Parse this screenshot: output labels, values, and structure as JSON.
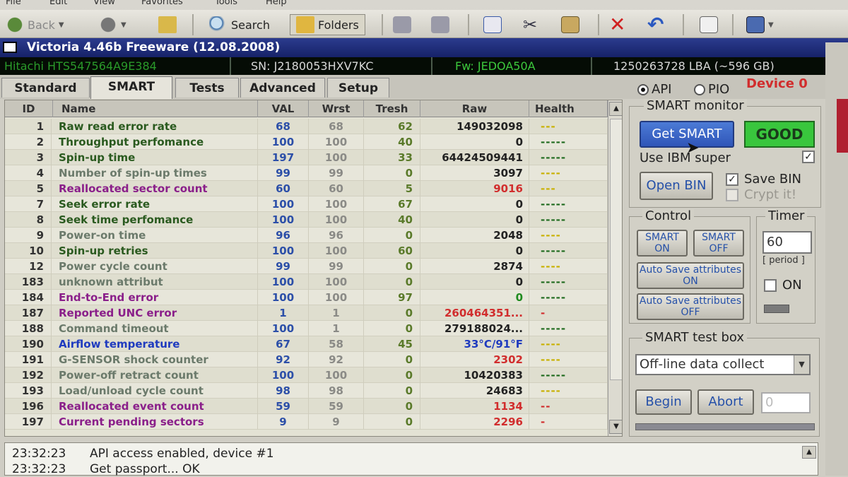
{
  "menu": [
    "File",
    "Edit",
    "View",
    "Favorites",
    "Tools",
    "Help"
  ],
  "toolbar": {
    "back": "Back",
    "search": "Search",
    "folders": "Folders"
  },
  "window": {
    "title": "Victoria 4.46b Freeware (12.08.2008)"
  },
  "drive_info": {
    "model": "Hitachi HTS547564A9E384",
    "serial": "SN: J2180053HXV7KC",
    "firmware": "Fw: JEDOA50A",
    "lba": "1250263728 LBA (~596 GB)"
  },
  "tabs": [
    "Standard",
    "SMART",
    "Tests",
    "Advanced",
    "Setup"
  ],
  "active_tab": "SMART",
  "mode": {
    "api": "API",
    "pio": "PIO",
    "selected": "API",
    "device": "Device 0"
  },
  "columns": [
    "ID",
    "Name",
    "VAL",
    "Wrst",
    "Tresh",
    "Raw",
    "Health"
  ],
  "rows": [
    {
      "id": "1",
      "name": "Raw read error rate",
      "val": "68",
      "wrst": "68",
      "tresh": "62",
      "raw": "149032098",
      "health": "---",
      "name_color": "#2a5a1f",
      "raw_color": "#222222",
      "health_color": "#c8b000"
    },
    {
      "id": "2",
      "name": "Throughput perfomance",
      "val": "100",
      "wrst": "100",
      "tresh": "40",
      "raw": "0",
      "health": "-----",
      "name_color": "#2a5a1f",
      "raw_color": "#222222",
      "health_color": "#1f6b1f"
    },
    {
      "id": "3",
      "name": "Spin-up time",
      "val": "197",
      "wrst": "100",
      "tresh": "33",
      "raw": "64424509441",
      "health": "-----",
      "name_color": "#2a5a1f",
      "raw_color": "#222222",
      "health_color": "#1f6b1f"
    },
    {
      "id": "4",
      "name": "Number of spin-up times",
      "val": "99",
      "wrst": "99",
      "tresh": "0",
      "raw": "3097",
      "health": "----",
      "name_color": "#6b7a6b",
      "raw_color": "#222222",
      "health_color": "#c8b000"
    },
    {
      "id": "5",
      "name": "Reallocated sector count",
      "val": "60",
      "wrst": "60",
      "tresh": "5",
      "raw": "9016",
      "health": "---",
      "name_color": "#8a1f8a",
      "raw_color": "#d12d2d",
      "health_color": "#c8b000"
    },
    {
      "id": "7",
      "name": "Seek error rate",
      "val": "100",
      "wrst": "100",
      "tresh": "67",
      "raw": "0",
      "health": "-----",
      "name_color": "#2a5a1f",
      "raw_color": "#222222",
      "health_color": "#1f6b1f"
    },
    {
      "id": "8",
      "name": "Seek time perfomance",
      "val": "100",
      "wrst": "100",
      "tresh": "40",
      "raw": "0",
      "health": "-----",
      "name_color": "#2a5a1f",
      "raw_color": "#222222",
      "health_color": "#1f6b1f"
    },
    {
      "id": "9",
      "name": "Power-on time",
      "val": "96",
      "wrst": "96",
      "tresh": "0",
      "raw": "2048",
      "health": "----",
      "name_color": "#6b7a6b",
      "raw_color": "#222222",
      "health_color": "#c8b000"
    },
    {
      "id": "10",
      "name": "Spin-up retries",
      "val": "100",
      "wrst": "100",
      "tresh": "60",
      "raw": "0",
      "health": "-----",
      "name_color": "#2a5a1f",
      "raw_color": "#222222",
      "health_color": "#1f6b1f"
    },
    {
      "id": "12",
      "name": "Power cycle count",
      "val": "99",
      "wrst": "99",
      "tresh": "0",
      "raw": "2874",
      "health": "----",
      "name_color": "#6b7a6b",
      "raw_color": "#222222",
      "health_color": "#c8b000"
    },
    {
      "id": "183",
      "name": "unknown attribut",
      "val": "100",
      "wrst": "100",
      "tresh": "0",
      "raw": "0",
      "health": "-----",
      "name_color": "#6b7a6b",
      "raw_color": "#222222",
      "health_color": "#1f6b1f"
    },
    {
      "id": "184",
      "name": "End-to-End error",
      "val": "100",
      "wrst": "100",
      "tresh": "97",
      "raw": "0",
      "health": "-----",
      "name_color": "#8a1f8a",
      "raw_color": "#1f8a1f",
      "health_color": "#1f6b1f"
    },
    {
      "id": "187",
      "name": "Reported UNC error",
      "val": "1",
      "wrst": "1",
      "tresh": "0",
      "raw": "260464351...",
      "health": "-",
      "name_color": "#8a1f8a",
      "raw_color": "#d12d2d",
      "health_color": "#d12d2d"
    },
    {
      "id": "188",
      "name": "Command timeout",
      "val": "100",
      "wrst": "1",
      "tresh": "0",
      "raw": "279188024...",
      "health": "-----",
      "name_color": "#6b7a6b",
      "raw_color": "#222222",
      "health_color": "#1f6b1f"
    },
    {
      "id": "190",
      "name": "Airflow temperature",
      "val": "67",
      "wrst": "58",
      "tresh": "45",
      "raw": "33°C/91°F",
      "health": "----",
      "name_color": "#1f3bbf",
      "raw_color": "#1f3bbf",
      "health_color": "#c8b000"
    },
    {
      "id": "191",
      "name": "G-SENSOR shock counter",
      "val": "92",
      "wrst": "92",
      "tresh": "0",
      "raw": "2302",
      "health": "----",
      "name_color": "#6b7a6b",
      "raw_color": "#d12d2d",
      "health_color": "#c8b000"
    },
    {
      "id": "192",
      "name": "Power-off retract count",
      "val": "100",
      "wrst": "100",
      "tresh": "0",
      "raw": "10420383",
      "health": "-----",
      "name_color": "#6b7a6b",
      "raw_color": "#222222",
      "health_color": "#1f6b1f"
    },
    {
      "id": "193",
      "name": "Load/unload cycle count",
      "val": "98",
      "wrst": "98",
      "tresh": "0",
      "raw": "24683",
      "health": "----",
      "name_color": "#6b7a6b",
      "raw_color": "#222222",
      "health_color": "#c8b000"
    },
    {
      "id": "196",
      "name": "Reallocated event count",
      "val": "59",
      "wrst": "59",
      "tresh": "0",
      "raw": "1134",
      "health": "--",
      "name_color": "#8a1f8a",
      "raw_color": "#d12d2d",
      "health_color": "#d12d2d"
    },
    {
      "id": "197",
      "name": "Current pending sectors",
      "val": "9",
      "wrst": "9",
      "tresh": "0",
      "raw": "2296",
      "health": "-",
      "name_color": "#8a1f8a",
      "raw_color": "#d12d2d",
      "health_color": "#d12d2d"
    }
  ],
  "smart_monitor": {
    "title": "SMART monitor",
    "get_smart": "Get SMART",
    "status": "GOOD",
    "use_ibm": "Use IBM super",
    "use_ibm_checked": true,
    "open_bin": "Open BIN",
    "save_bin": "Save BIN",
    "save_bin_checked": true,
    "crypt": "Crypt it!",
    "crypt_checked": false
  },
  "control": {
    "title": "Control",
    "smart_on": "SMART ON",
    "smart_off": "SMART OFF",
    "auto_save_on": "Auto Save attributes ON",
    "auto_save_off": "Auto Save attributes OFF"
  },
  "timer": {
    "title": "Timer",
    "period_value": "60",
    "period_label": "[ period ]",
    "on_label": "ON",
    "on_checked": false
  },
  "test_box": {
    "title": "SMART test box",
    "selected": "Off-line data collect",
    "begin": "Begin",
    "abort": "Abort",
    "value": "0"
  },
  "log": [
    {
      "time": "23:32:23",
      "text": "API access enabled, device #1"
    },
    {
      "time": "23:32:23",
      "text": "Get passport... OK"
    }
  ]
}
